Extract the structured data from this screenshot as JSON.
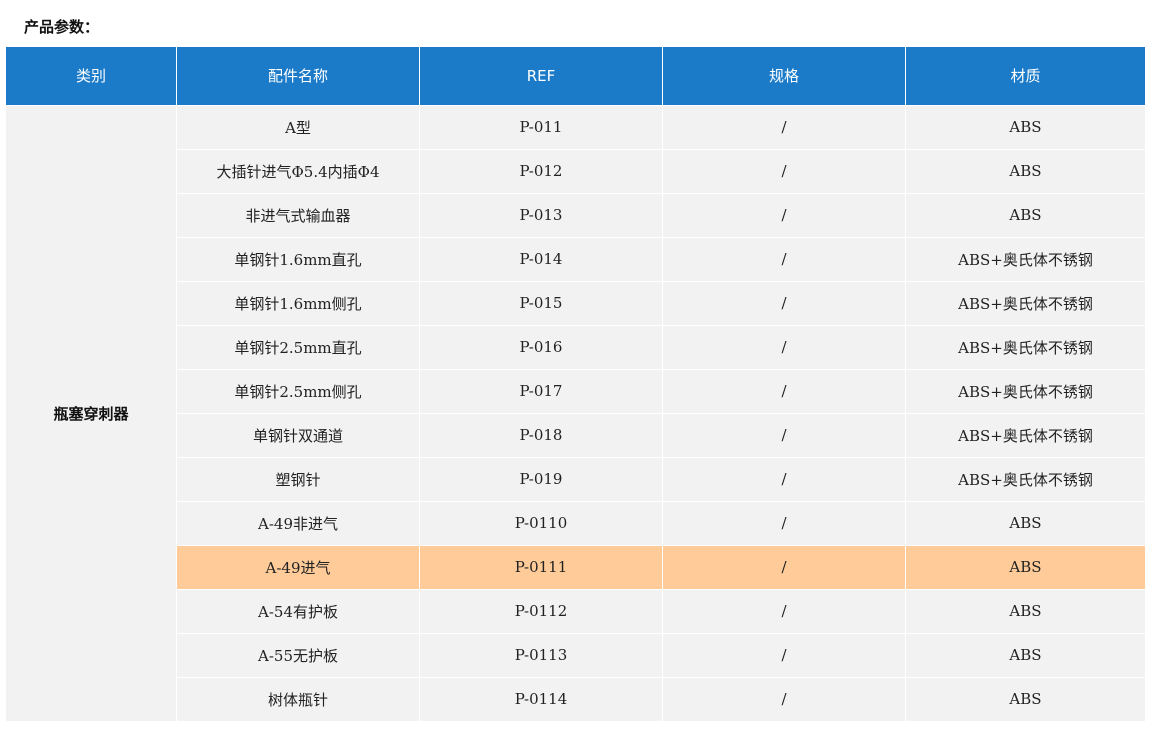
{
  "page": {
    "title": "产品参数："
  },
  "table": {
    "headers": [
      "类别",
      "配件名称",
      "REF",
      "规格",
      "材质"
    ],
    "category": "瓶塞穿刺器",
    "highlight_row": 10,
    "highlight_color": "#ffcc99",
    "header_color": "#1b7bc9",
    "rows": [
      {
        "name": "A型",
        "ref": "P-011",
        "spec": "/",
        "material": "ABS"
      },
      {
        "name": "大插针进气Φ5.4内插Φ4",
        "ref": "P-012",
        "spec": "/",
        "material": "ABS"
      },
      {
        "name": "非进气式输血器",
        "ref": "P-013",
        "spec": "/",
        "material": "ABS"
      },
      {
        "name": "单钢针1.6mm直孔",
        "ref": "P-014",
        "spec": "/",
        "material": "ABS+奥氏体不锈钢"
      },
      {
        "name": "单钢针1.6mm侧孔",
        "ref": "P-015",
        "spec": "/",
        "material": "ABS+奥氏体不锈钢"
      },
      {
        "name": "单钢针2.5mm直孔",
        "ref": "P-016",
        "spec": "/",
        "material": "ABS+奥氏体不锈钢"
      },
      {
        "name": "单钢针2.5mm侧孔",
        "ref": "P-017",
        "spec": "/",
        "material": "ABS+奥氏体不锈钢"
      },
      {
        "name": "单钢针双通道",
        "ref": "P-018",
        "spec": "/",
        "material": "ABS+奥氏体不锈钢"
      },
      {
        "name": "塑钢针",
        "ref": "P-019",
        "spec": "/",
        "material": "ABS+奥氏体不锈钢"
      },
      {
        "name": "A-49非进气",
        "ref": "P-0110",
        "spec": "/",
        "material": "ABS"
      },
      {
        "name": "A-49进气",
        "ref": "P-0111",
        "spec": "/",
        "material": "ABS"
      },
      {
        "name": "A-54有护板",
        "ref": "P-0112",
        "spec": "/",
        "material": "ABS"
      },
      {
        "name": "A-55无护板",
        "ref": "P-0113",
        "spec": "/",
        "material": "ABS"
      },
      {
        "name": "树体瓶针",
        "ref": "P-0114",
        "spec": "/",
        "material": "ABS"
      }
    ]
  }
}
